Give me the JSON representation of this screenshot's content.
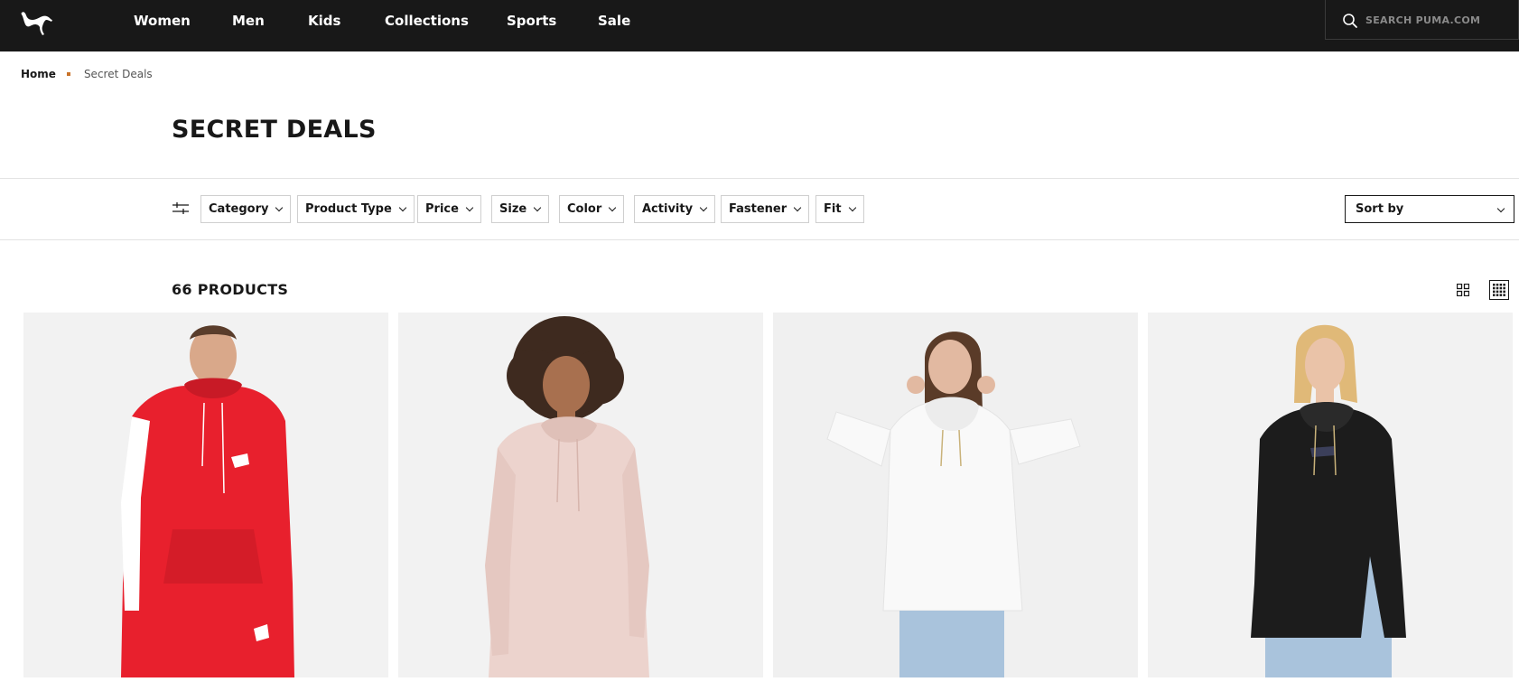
{
  "brand": {
    "logo": "puma-cat-logo"
  },
  "nav": {
    "items": [
      {
        "label": "Women"
      },
      {
        "label": "Men"
      },
      {
        "label": "Kids"
      },
      {
        "label": "Collections"
      },
      {
        "label": "Sports"
      },
      {
        "label": "Sale"
      }
    ]
  },
  "search": {
    "placeholder": "SEARCH PUMA.COM",
    "icon": "search-icon"
  },
  "breadcrumb": {
    "home": "Home",
    "current": "Secret Deals"
  },
  "page": {
    "title": "SECRET DEALS"
  },
  "filters": {
    "icon": "sliders-icon",
    "items": [
      {
        "label": "Category"
      },
      {
        "label": "Product Type"
      },
      {
        "label": "Price"
      },
      {
        "label": "Size"
      },
      {
        "label": "Color"
      },
      {
        "label": "Activity"
      },
      {
        "label": "Fastener"
      },
      {
        "label": "Fit"
      }
    ],
    "sort_label": "Sort by"
  },
  "results": {
    "count_label": "66 PRODUCTS",
    "view_options": [
      "grid-large-icon",
      "grid-small-icon"
    ],
    "active_view": "grid-small-icon"
  },
  "products": [
    {
      "image": "red-hoodie-photo",
      "color": "#e8202d"
    },
    {
      "image": "pink-hoodie-photo",
      "color": "#ecd3cd"
    },
    {
      "image": "white-hoodie-photo",
      "color": "#f7f7f7"
    },
    {
      "image": "black-hoodie-photo",
      "color": "#1c1c1c"
    }
  ],
  "colors": {
    "header_bg": "#181818",
    "breadcrumb_accent": "#c9732a"
  }
}
